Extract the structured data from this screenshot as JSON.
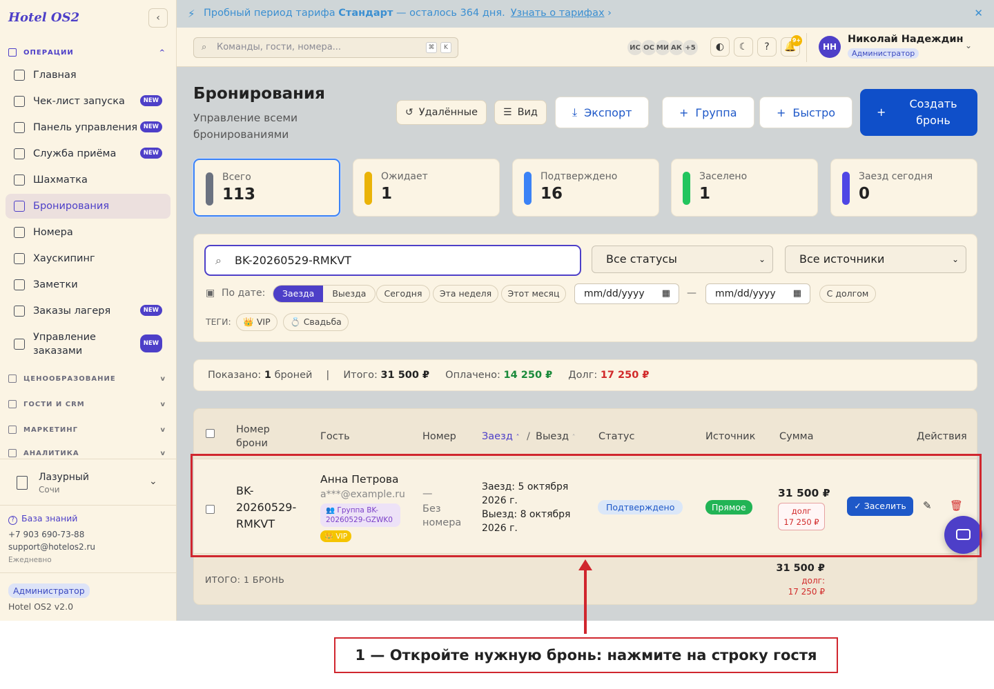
{
  "sidebar": {
    "brand": "Hotel OS2",
    "collapse_icon": "‹",
    "sections": {
      "operations": "ОПЕРАЦИИ",
      "pricing": "ЦЕНООБРАЗОВАНИЕ",
      "guests": "ГОСТИ И CRM",
      "marketing": "МАРКЕТИНГ",
      "analytics": "АНАЛИТИКА"
    },
    "new_badge": "NEW",
    "items": [
      {
        "label": "Главная",
        "icon": "grid-icon"
      },
      {
        "label": "Чек-лист запуска",
        "icon": "rocket-icon"
      },
      {
        "label": "Панель управления",
        "icon": "gauge-icon"
      },
      {
        "label": "Служба приёма",
        "icon": "bell-desk-icon"
      },
      {
        "label": "Шахматка",
        "icon": "table-icon"
      },
      {
        "label": "Бронирования",
        "icon": "clipboard-icon"
      },
      {
        "label": "Номера",
        "icon": "building-icon"
      },
      {
        "label": "Хаускипинг",
        "icon": "sparkle-icon"
      },
      {
        "label": "Заметки",
        "icon": "note-icon"
      },
      {
        "label": "Заказы лагеря",
        "icon": "tent-icon"
      },
      {
        "label": "Управление заказами",
        "icon": "dollar-doc-icon"
      }
    ],
    "hotel": {
      "name": "Лазурный",
      "city": "Сочи"
    },
    "knowledge_base": "База знаний",
    "phone": "+7 903 690-73-88",
    "email": "support@hotelos2.ru",
    "schedule": "Ежедневно",
    "role": "Администратор",
    "version": "Hotel OS2 v2.0"
  },
  "banner": {
    "text_pre": "Пробный период тарифа",
    "plan": "Стандарт",
    "text_post": "— осталось 364 дня.",
    "link": "Узнать о тарифах",
    "link_arrow": "›",
    "close": "✕"
  },
  "header": {
    "command_placeholder": "Команды, гости, номера...",
    "kbd1": "⌘",
    "kbd2": "K",
    "avatars": [
      "ИС",
      "ОС",
      "МИ",
      "АК",
      "+5"
    ],
    "notif_count": "9+",
    "user_initials": "НН",
    "user_name": "Николай Надеждин",
    "user_role": "Администратор"
  },
  "page": {
    "title": "Бронирования",
    "subtitle": "Управление всеми бронированиями",
    "buttons": {
      "deleted": "Удалённые",
      "view": "Вид",
      "export": "Экспорт",
      "group": "Группа",
      "quick": "Быстро",
      "create": "Создать бронь"
    }
  },
  "stats": [
    {
      "label": "Всего",
      "value": "113",
      "color": "#6b7280"
    },
    {
      "label": "Ожидает",
      "value": "1",
      "color": "#eab308"
    },
    {
      "label": "Подтверждено",
      "value": "16",
      "color": "#3b82f6"
    },
    {
      "label": "Заселено",
      "value": "1",
      "color": "#22c55e"
    },
    {
      "label": "Заезд сегодня",
      "value": "0",
      "color": "#4f46e5"
    }
  ],
  "filters": {
    "search_value": "BK-20260529-RMKVT",
    "status_select": "Все статусы",
    "source_select": "Все источники",
    "by_date": "По дате:",
    "seg_checkin": "Заезда",
    "seg_checkout": "Выезда",
    "today": "Сегодня",
    "this_week": "Эта неделя",
    "this_month": "Этот месяц",
    "date_placeholder": "mm/dd/yyyy",
    "dash": "—",
    "with_debt": "С долгом",
    "tags_label": "ТЕГИ:",
    "tag_vip": "👑 VIP",
    "tag_wedding": "💍 Свадьба"
  },
  "summary": {
    "shown_label": "Показано:",
    "shown_count": "1",
    "shown_unit": "броней",
    "total_label": "Итого:",
    "total": "31 500 ₽",
    "paid_label": "Оплачено:",
    "paid": "14 250 ₽",
    "debt_label": "Долг:",
    "debt": "17 250 ₽"
  },
  "table": {
    "headers": {
      "booking_no": "Номер брони",
      "guest": "Гость",
      "room": "Номер",
      "checkin": "Заезд",
      "slash": "/",
      "checkout": "Выезд",
      "status": "Статус",
      "source": "Источник",
      "amount": "Сумма",
      "actions": "Действия"
    },
    "row": {
      "booking_no": "BK-20260529-RMKVT",
      "guest_name": "Анна Петрова",
      "guest_email": "a***@example.ru",
      "group": "👥 Группа BK-20260529-GZWK0",
      "vip": "👑 VIP",
      "room_dash": "—",
      "room_none": "Без номера",
      "checkin": "Заезд: 5 октября 2026 г.",
      "checkout": "Выезд: 8 октября 2026 г.",
      "status": "Подтверждено",
      "source": "Прямое",
      "amount": "31 500 ₽",
      "debt_label": "долг",
      "debt": "17 250 ₽",
      "checkin_btn": "Заселить"
    },
    "footer": {
      "label": "ИТОГО: 1 БРОНЬ",
      "amount": "31 500 ₽",
      "debt_label": "долг:",
      "debt": "17 250 ₽"
    }
  },
  "annotation": {
    "callout": "1 — Откройте нужную бронь: нажмите на строку гостя"
  }
}
